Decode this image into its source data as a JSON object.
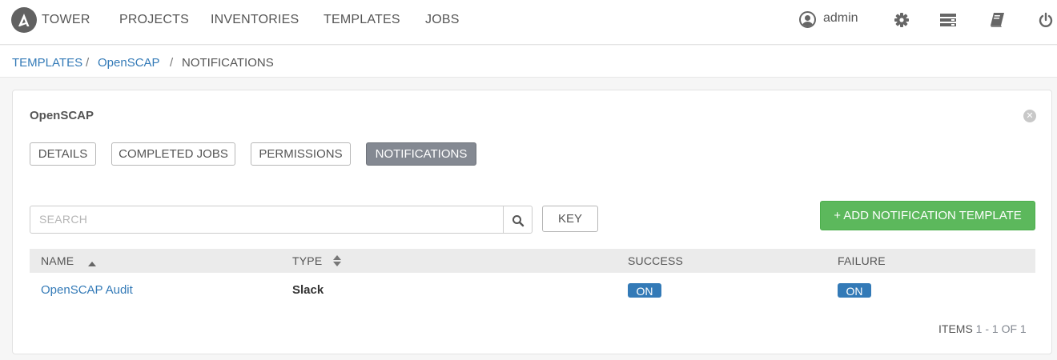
{
  "nav": {
    "brand": "TOWER",
    "links": [
      "PROJECTS",
      "INVENTORIES",
      "TEMPLATES",
      "JOBS"
    ],
    "user": "admin",
    "icons": [
      "user-icon",
      "gear-icon",
      "server-icon",
      "book-icon",
      "power-icon"
    ]
  },
  "breadcrumb": {
    "items": [
      "TEMPLATES",
      "OpenSCAP",
      "NOTIFICATIONS"
    ],
    "separator": "/"
  },
  "panel": {
    "title": "OpenSCAP",
    "tabs": [
      "DETAILS",
      "COMPLETED JOBS",
      "PERMISSIONS",
      "NOTIFICATIONS"
    ],
    "active_tab": "NOTIFICATIONS",
    "search_placeholder": "SEARCH",
    "key_label": "KEY",
    "add_label": "+ ADD NOTIFICATION TEMPLATE",
    "columns": [
      "NAME",
      "TYPE",
      "SUCCESS",
      "FAILURE"
    ],
    "rows": [
      {
        "name": "OpenSCAP Audit",
        "type": "Slack",
        "success": "ON",
        "failure": "ON"
      }
    ],
    "items_label": "ITEMS",
    "items_range": "1 - 1 OF 1"
  },
  "colors": {
    "accent": "#337ab7",
    "add_button": "#5cb85c",
    "active_tab": "#848992"
  }
}
